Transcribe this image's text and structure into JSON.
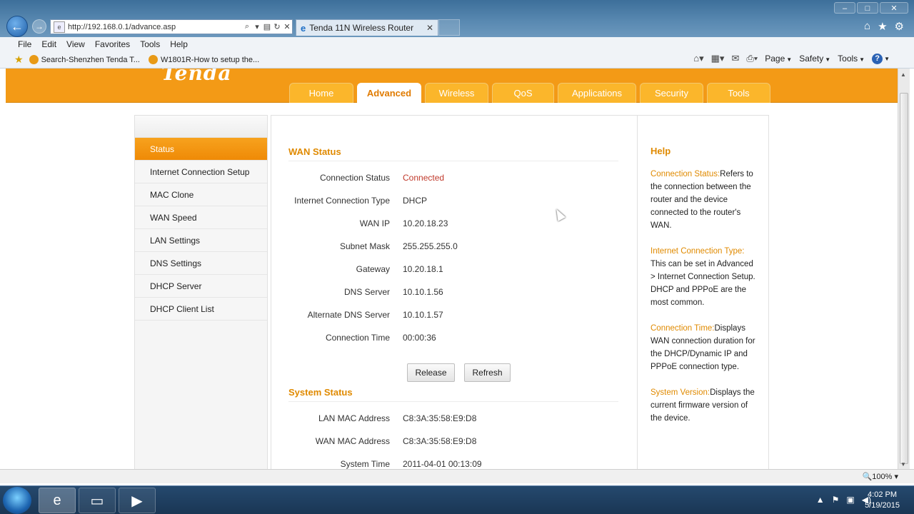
{
  "browser": {
    "url": "http://192.168.0.1/advance.asp",
    "tab_title": "Tenda 11N Wireless Router",
    "window_buttons": [
      "–",
      "□",
      "✕"
    ],
    "menu": [
      "File",
      "Edit",
      "View",
      "Favorites",
      "Tools",
      "Help"
    ],
    "favorites": [
      "Search-Shenzhen Tenda T...",
      "W1801R-How to setup the..."
    ],
    "commands": [
      "Page",
      "Safety",
      "Tools"
    ],
    "zoom": "100%"
  },
  "header": {
    "logo": "Tenda",
    "tabs": [
      {
        "label": "Home"
      },
      {
        "label": "Advanced"
      },
      {
        "label": "Wireless"
      },
      {
        "label": "QoS"
      },
      {
        "label": "Applications"
      },
      {
        "label": "Security"
      },
      {
        "label": "Tools"
      }
    ],
    "active_tab": "Advanced"
  },
  "sidebar": {
    "items": [
      {
        "label": "Status"
      },
      {
        "label": "Internet Connection Setup"
      },
      {
        "label": "MAC Clone"
      },
      {
        "label": "WAN Speed"
      },
      {
        "label": "LAN Settings"
      },
      {
        "label": "DNS Settings"
      },
      {
        "label": "DHCP Server"
      },
      {
        "label": "DHCP Client List"
      }
    ],
    "active_item": "Status"
  },
  "wan_status": {
    "title": "WAN Status",
    "rows": [
      {
        "label": "Connection Status",
        "value": "Connected"
      },
      {
        "label": "Internet Connection Type",
        "value": "DHCP"
      },
      {
        "label": "WAN IP",
        "value": "10.20.18.23"
      },
      {
        "label": "Subnet Mask",
        "value": "255.255.255.0"
      },
      {
        "label": "Gateway",
        "value": "10.20.18.1"
      },
      {
        "label": "DNS Server",
        "value": "10.10.1.56"
      },
      {
        "label": "Alternate DNS Server",
        "value": "10.10.1.57"
      },
      {
        "label": "Connection Time",
        "value": "00:00:36"
      }
    ],
    "release_label": "Release",
    "refresh_label": "Refresh"
  },
  "system_status": {
    "title": "System Status",
    "rows": [
      {
        "label": "LAN MAC Address",
        "value": "C8:3A:35:58:E9:D8"
      },
      {
        "label": "WAN MAC Address",
        "value": "C8:3A:35:58:E9:D8"
      },
      {
        "label": "System Time",
        "value": "2011-04-01 00:13:09"
      }
    ]
  },
  "help": {
    "title": "Help",
    "entries": [
      {
        "key": "Connection Status:",
        "text": "Refers to the connection between the router and the device connected to the router's WAN."
      },
      {
        "key": "Internet Connection Type:",
        "text": "This can be set in Advanced > Internet Connection Setup. DHCP and PPPoE are the most common."
      },
      {
        "key": "Connection Time:",
        "text": "Displays WAN connection duration for the DHCP/Dynamic IP and PPPoE connection type."
      },
      {
        "key": "System Version:",
        "text": "Displays the current firmware version of the device."
      }
    ]
  },
  "taskbar": {
    "time": "4:02 PM",
    "date": "5/19/2015"
  },
  "colors": {
    "brand_orange": "#f39a16",
    "accent_text": "#e08a00",
    "connected": "#c0392b"
  }
}
